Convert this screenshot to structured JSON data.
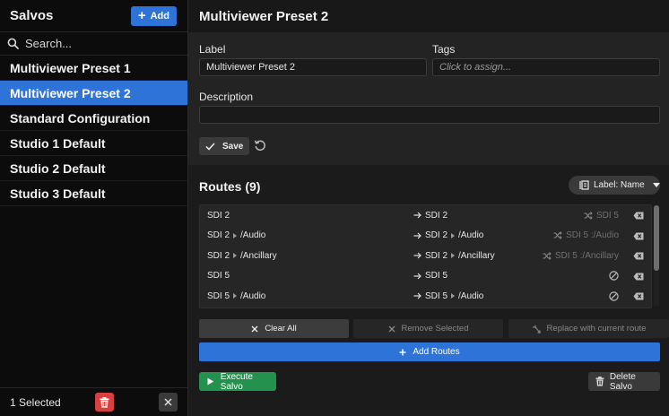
{
  "sidebar": {
    "title": "Salvos",
    "add_label": "Add",
    "search_placeholder": "Search...",
    "items": [
      {
        "label": "Multiviewer Preset 1",
        "selected": false
      },
      {
        "label": "Multiviewer Preset 2",
        "selected": true
      },
      {
        "label": "Standard Configuration",
        "selected": false
      },
      {
        "label": "Studio 1 Default",
        "selected": false
      },
      {
        "label": "Studio 2 Default",
        "selected": false
      },
      {
        "label": "Studio 3 Default",
        "selected": false
      }
    ],
    "footer": {
      "selected_text": "1 Selected"
    }
  },
  "main": {
    "title": "Multiviewer Preset 2",
    "form": {
      "label_caption": "Label",
      "label_value": "Multiviewer Preset 2",
      "tags_caption": "Tags",
      "tags_placeholder": "Click to assign...",
      "description_caption": "Description",
      "description_value": "",
      "save_label": "Save"
    },
    "routes": {
      "title": "Routes (9)",
      "label_dropdown": "Label: Name",
      "rows": [
        {
          "src": "SDI 2",
          "src_sub": "",
          "dst": "SDI 2",
          "dst_sub": "",
          "status": "SDI 5",
          "status_icon": "shuffle-icon"
        },
        {
          "src": "SDI 2",
          "src_sub": "/Audio",
          "dst": "SDI 2",
          "dst_sub": "/Audio",
          "status": "SDI 5 :/Audio",
          "status_icon": "shuffle-icon"
        },
        {
          "src": "SDI 2",
          "src_sub": "/Ancillary",
          "dst": "SDI 2",
          "dst_sub": "/Ancillary",
          "status": "SDI 5 :/Ancillary",
          "status_icon": "shuffle-icon"
        },
        {
          "src": "SDI 5",
          "src_sub": "",
          "dst": "SDI 5",
          "dst_sub": "",
          "status": "",
          "status_icon": "no-entry-icon"
        },
        {
          "src": "SDI 5",
          "src_sub": "/Audio",
          "dst": "SDI 5",
          "dst_sub": "/Audio",
          "status": "",
          "status_icon": "no-entry-icon"
        }
      ]
    },
    "actions": {
      "clear_all": "Clear All",
      "remove_selected": "Remove Selected",
      "replace": "Replace with current route",
      "add_routes": "Add Routes",
      "execute": "Execute Salvo",
      "delete": "Delete Salvo"
    }
  },
  "colors": {
    "accent": "#2e73d8",
    "execute": "#25914f",
    "danger": "#d64040"
  }
}
